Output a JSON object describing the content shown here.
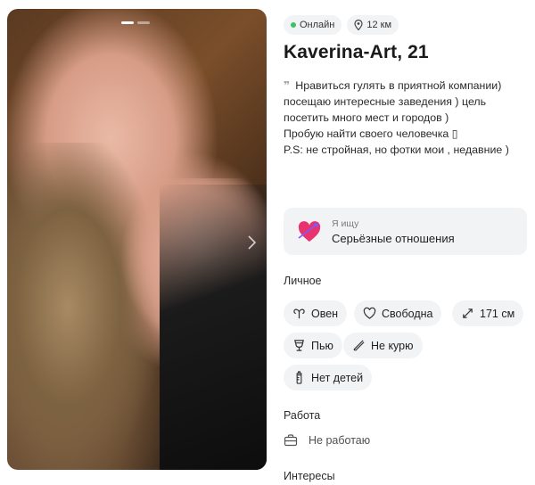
{
  "profile": {
    "status_online": "Онлайн",
    "distance": "12 км",
    "name_age": "Kaverina-Art, 21",
    "bio_lines": [
      "Нравиться гулять в приятной компании) посещаю интересные заведения ) цель посетить много мест и городов )",
      "Пробую найти своего человечка ▯",
      "P.S: не стройная, но фотки мои , недавние )"
    ],
    "seeking": {
      "label": "Я ищу",
      "value": "Серьёзные отношения"
    }
  },
  "sections": {
    "personal": "Личное",
    "work": "Работа",
    "interests": "Интересы"
  },
  "personal_tags": {
    "zodiac": "Овен",
    "relationship": "Свободна",
    "height": "171 см",
    "drinking": "Пью",
    "smoking": "Не курю",
    "children": "Нет детей"
  },
  "work": {
    "value": "Не работаю"
  },
  "colors": {
    "online_dot": "#3cc264",
    "chip_bg": "#f2f3f5",
    "heart": "#e8336f"
  },
  "icons": {
    "distance": "location-pin-icon",
    "quote": "quote-icon",
    "seek": "heart-arrow-icon",
    "zodiac": "aries-icon",
    "relationship": "heart-outline-icon",
    "height": "expand-arrows-icon",
    "drinking": "glass-icon",
    "smoking": "no-smoking-icon",
    "children": "baby-bottle-icon",
    "work": "briefcase-icon"
  }
}
